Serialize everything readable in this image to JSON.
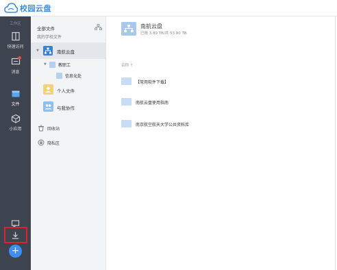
{
  "app": {
    "title": "校园云盘",
    "colors": {
      "brand": "#3b8de3",
      "rail": "#3e444f",
      "highlight": "#d9232f",
      "add": "#3e8ef7",
      "badge": "#e84b4b"
    }
  },
  "rail": {
    "section_label": "工作区",
    "items": [
      {
        "label": "快速访问",
        "icon": "quick-access-icon"
      },
      {
        "label": "消息",
        "icon": "message-icon"
      },
      {
        "label": "文件",
        "icon": "file-icon"
      },
      {
        "label": "小应用",
        "icon": "apps-icon"
      }
    ],
    "bottom_icons": [
      "feedback-icon",
      "download-icon"
    ],
    "add_label": "+"
  },
  "tree": {
    "title": "全部文件",
    "subtitle": "我的学校文件",
    "root": {
      "label": "南航云盘",
      "icon": "org-icon"
    },
    "staff": {
      "label": "教职工",
      "icon": "folder-icon"
    },
    "info": {
      "label": "信息化处",
      "icon": "folder-icon"
    },
    "personal": {
      "label": "个人文件",
      "icon": "personal-folder-icon"
    },
    "shared": {
      "label": "与我协作",
      "icon": "collab-folder-icon"
    },
    "bin": {
      "label": "回收站",
      "icon": "trash-icon"
    },
    "private": {
      "label": "隐私区",
      "icon": "lock-icon"
    }
  },
  "main": {
    "title": "南航云盘",
    "quota": "已用 3.89 TB/共 53.00 TB",
    "list_header": "名称 ↑",
    "files": [
      {
        "name": "【常用软件下载】",
        "icon": "folder-icon"
      },
      {
        "name": "南航云盘使用指南",
        "icon": "folder-icon"
      },
      {
        "name": "南京航空航天大学公共资料库",
        "icon": "folder-icon"
      }
    ]
  }
}
